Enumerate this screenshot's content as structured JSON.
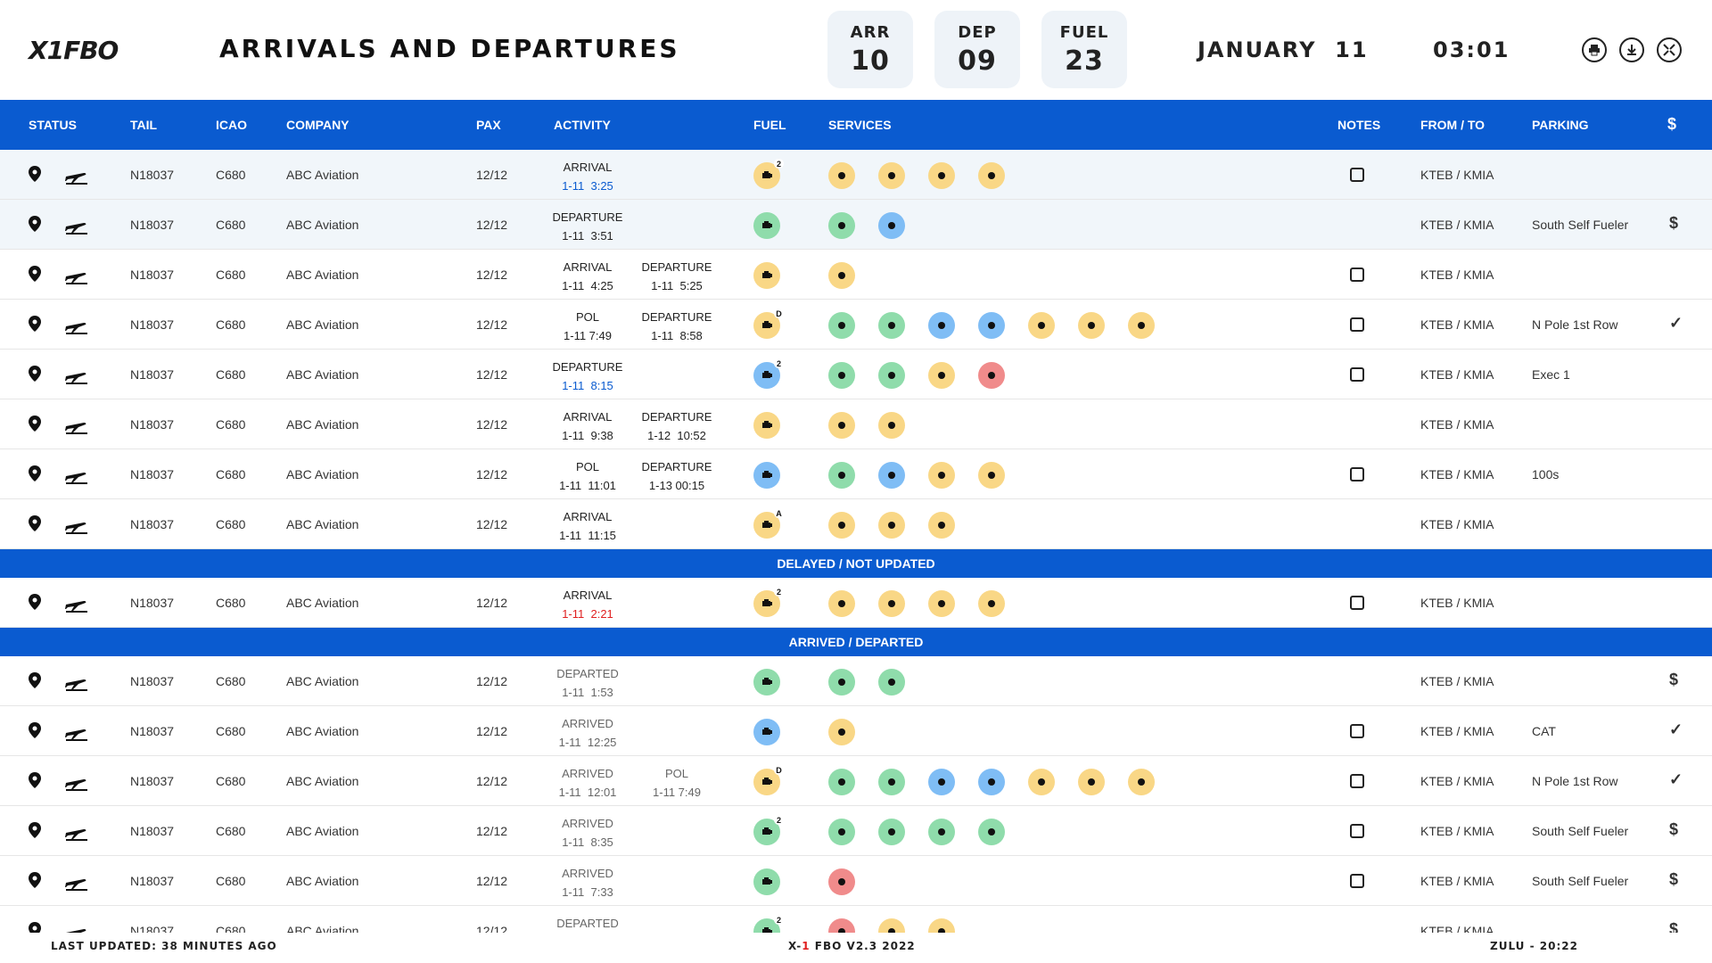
{
  "header": {
    "logo": "X1FBO",
    "title": "ARRIVALS AND DEPARTURES",
    "stats": [
      {
        "label": "ARR",
        "value": "10"
      },
      {
        "label": "DEP",
        "value": "09"
      },
      {
        "label": "FUEL",
        "value": "23"
      }
    ],
    "date": "JANUARY  11",
    "time": "03:01",
    "buttons": [
      "print-icon",
      "download-icon",
      "fullscreen-exit-icon"
    ]
  },
  "columns": [
    "STATUS",
    "TAIL",
    "ICAO",
    "COMPANY",
    "PAX",
    "ACTIVITY",
    "FUEL",
    "SERVICES",
    "NOTES",
    "FROM / TO",
    "PARKING",
    "$"
  ],
  "sections": {
    "delayed": "DELAYED / NOT UPDATED",
    "arrived": "ARRIVED / DEPARTED"
  },
  "rows": [
    {
      "tail": "N18037",
      "icao": "C680",
      "company": "ABC Aviation",
      "pax": "12/12",
      "a1": "ARRIVAL",
      "t1": "1-11  3:25",
      "t1c": "blue",
      "a2": "",
      "t2": "",
      "fuel": "y",
      "fuelBadge": "2",
      "services": [
        "y",
        "y",
        "y",
        "y"
      ],
      "note": true,
      "route": "KTEB / KMIA",
      "parking": "",
      "pay": ""
    },
    {
      "tail": "N18037",
      "icao": "C680",
      "company": "ABC Aviation",
      "pax": "12/12",
      "a1": "DEPARTURE",
      "t1": "1-11  3:51",
      "t1c": "",
      "a2": "",
      "t2": "",
      "fuel": "g",
      "fuelBadge": "",
      "services": [
        "g",
        "b"
      ],
      "note": false,
      "route": "KTEB / KMIA",
      "parking": "South Self Fueler",
      "pay": "$"
    },
    {
      "tail": "N18037",
      "icao": "C680",
      "company": "ABC Aviation",
      "pax": "12/12",
      "a1": "ARRIVAL",
      "t1": "1-11  4:25",
      "t1c": "",
      "a2": "DEPARTURE",
      "t2": "1-11  5:25",
      "fuel": "y",
      "fuelBadge": "",
      "services": [
        "y"
      ],
      "note": true,
      "route": "KTEB / KMIA",
      "parking": "",
      "pay": ""
    },
    {
      "tail": "N18037",
      "icao": "C680",
      "company": "ABC Aviation",
      "pax": "12/12",
      "a1": "POL",
      "t1": "1-11 7:49",
      "t1c": "",
      "a2": "DEPARTURE",
      "t2": "1-11  8:58",
      "fuel": "y",
      "fuelBadge": "D",
      "services": [
        "g",
        "g",
        "b",
        "b",
        "y",
        "y",
        "y"
      ],
      "note": true,
      "route": "KTEB / KMIA",
      "parking": "N Pole 1st Row",
      "pay": "✓"
    },
    {
      "tail": "N18037",
      "icao": "C680",
      "company": "ABC Aviation",
      "pax": "12/12",
      "a1": "DEPARTURE",
      "t1": "1-11  8:15",
      "t1c": "blue",
      "a2": "",
      "t2": "",
      "fuel": "b",
      "fuelBadge": "2",
      "services": [
        "g",
        "g",
        "y",
        "r"
      ],
      "note": true,
      "route": "KTEB / KMIA",
      "parking": "Exec 1",
      "pay": ""
    },
    {
      "tail": "N18037",
      "icao": "C680",
      "company": "ABC Aviation",
      "pax": "12/12",
      "a1": "ARRIVAL",
      "t1": "1-11  9:38",
      "t1c": "",
      "a2": "DEPARTURE",
      "t2": "1-12  10:52",
      "fuel": "y",
      "fuelBadge": "",
      "services": [
        "y",
        "y"
      ],
      "note": false,
      "route": "KTEB / KMIA",
      "parking": "",
      "pay": ""
    },
    {
      "tail": "N18037",
      "icao": "C680",
      "company": "ABC Aviation",
      "pax": "12/12",
      "a1": "POL",
      "t1": "1-11  11:01",
      "t1c": "",
      "a2": "DEPARTURE",
      "t2": "1-13 00:15",
      "fuel": "b",
      "fuelBadge": "",
      "services": [
        "g",
        "b",
        "y",
        "y"
      ],
      "note": true,
      "route": "KTEB / KMIA",
      "parking": "100s",
      "pay": ""
    },
    {
      "tail": "N18037",
      "icao": "C680",
      "company": "ABC Aviation",
      "pax": "12/12",
      "a1": "ARRIVAL",
      "t1": "1-11  11:15",
      "t1c": "",
      "a2": "",
      "t2": "",
      "fuel": "y",
      "fuelBadge": "A",
      "services": [
        "y",
        "y",
        "y"
      ],
      "note": false,
      "route": "KTEB / KMIA",
      "parking": "",
      "pay": ""
    }
  ],
  "delayed_rows": [
    {
      "tail": "N18037",
      "icao": "C680",
      "company": "ABC Aviation",
      "pax": "12/12",
      "a1": "ARRIVAL",
      "t1": "1-11  2:21",
      "t1c": "red",
      "a2": "",
      "t2": "",
      "fuel": "y",
      "fuelBadge": "2",
      "services": [
        "y",
        "y",
        "y",
        "y"
      ],
      "note": true,
      "route": "KTEB / KMIA",
      "parking": "",
      "pay": ""
    }
  ],
  "done_rows": [
    {
      "tail": "N18037",
      "icao": "C680",
      "company": "ABC Aviation",
      "pax": "12/12",
      "a1": "DEPARTED",
      "t1": "1-11  1:53",
      "t1c": "",
      "a2": "",
      "t2": "",
      "fuel": "g",
      "fuelBadge": "",
      "services": [
        "g",
        "g"
      ],
      "note": false,
      "route": "KTEB / KMIA",
      "parking": "",
      "pay": "$"
    },
    {
      "tail": "N18037",
      "icao": "C680",
      "company": "ABC Aviation",
      "pax": "12/12",
      "a1": "ARRIVED",
      "t1": "1-11  12:25",
      "t1c": "",
      "a2": "",
      "t2": "",
      "fuel": "b",
      "fuelBadge": "",
      "services": [
        "y"
      ],
      "note": true,
      "route": "KTEB / KMIA",
      "parking": "CAT",
      "pay": "✓"
    },
    {
      "tail": "N18037",
      "icao": "C680",
      "company": "ABC Aviation",
      "pax": "12/12",
      "a1": "ARRIVED",
      "t1": "1-11  12:01",
      "t1c": "",
      "a2": "POL",
      "t2": "1-11 7:49",
      "fuel": "y",
      "fuelBadge": "D",
      "services": [
        "g",
        "g",
        "b",
        "b",
        "y",
        "y",
        "y"
      ],
      "note": true,
      "route": "KTEB / KMIA",
      "parking": "N Pole 1st Row",
      "pay": "✓"
    },
    {
      "tail": "N18037",
      "icao": "C680",
      "company": "ABC Aviation",
      "pax": "12/12",
      "a1": "ARRIVED",
      "t1": "1-11  8:35",
      "t1c": "",
      "a2": "",
      "t2": "",
      "fuel": "g",
      "fuelBadge": "2",
      "services": [
        "g",
        "g",
        "g",
        "g"
      ],
      "note": true,
      "route": "KTEB / KMIA",
      "parking": "South Self Fueler",
      "pay": "$"
    },
    {
      "tail": "N18037",
      "icao": "C680",
      "company": "ABC Aviation",
      "pax": "12/12",
      "a1": "ARRIVED",
      "t1": "1-11  7:33",
      "t1c": "",
      "a2": "",
      "t2": "",
      "fuel": "g",
      "fuelBadge": "",
      "services": [
        "r"
      ],
      "note": true,
      "route": "KTEB / KMIA",
      "parking": "South Self Fueler",
      "pay": "$"
    },
    {
      "tail": "N18037",
      "icao": "C680",
      "company": "ABC Aviation",
      "pax": "12/12",
      "a1": "DEPARTED",
      "t1": "",
      "t1c": "",
      "a2": "",
      "t2": "",
      "fuel": "g",
      "fuelBadge": "2",
      "services": [
        "r",
        "y",
        "y"
      ],
      "note": false,
      "route": "KTEB / KMIA",
      "parking": "",
      "pay": "$"
    }
  ],
  "footer": {
    "updated": "LAST UPDATED: 38 MINUTES AGO",
    "version_a": "X-",
    "version_b": "1",
    "version_c": " FBO V2.3 2022",
    "zulu": "ZULU - 20:22"
  }
}
